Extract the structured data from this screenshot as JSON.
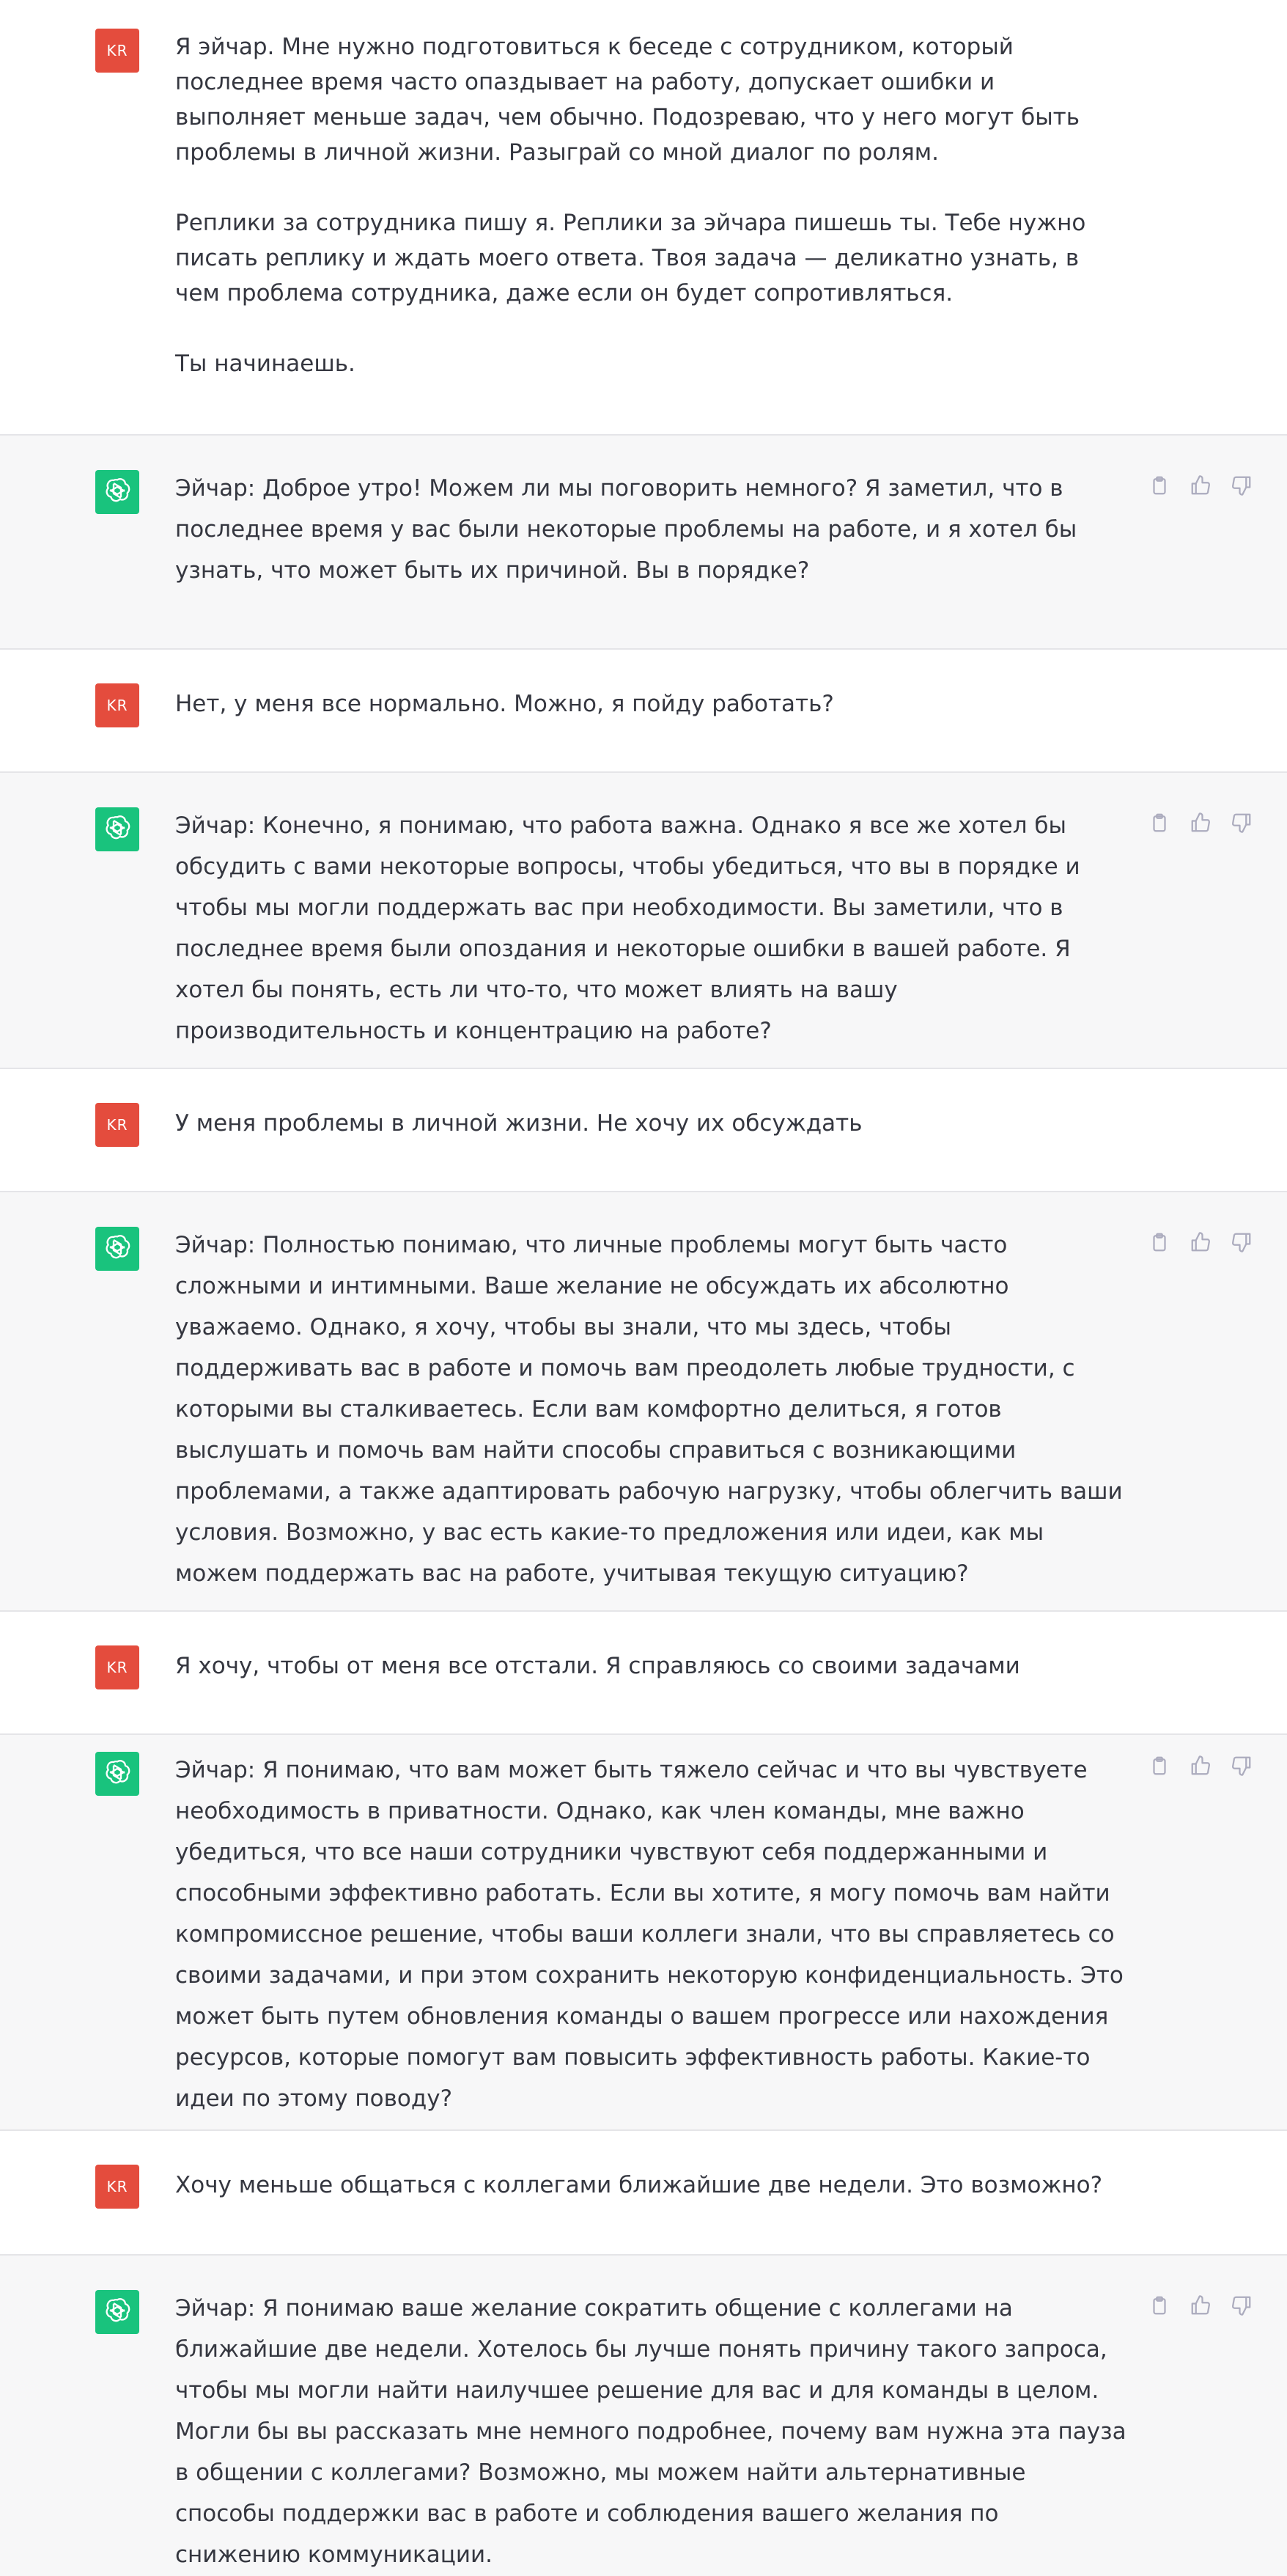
{
  "user": {
    "initials": "KR"
  },
  "messages": [
    {
      "role": "user",
      "paragraphs": [
        "Я эйчар. Мне нужно подготовиться к беседе с сотрудником, который последнее время часто опаздывает на работу, допускает ошибки и выполняет меньше задач, чем обычно. Подозреваю, что у него могут быть проблемы в личной жизни. Разыграй со мной диалог по ролям.",
        "Реплики за сотрудника пишу я. Реплики за эйчара пишешь ты. Тебе нужно писать реплику и ждать моего ответа. Твоя задача — деликатно узнать, в чем проблема сотрудника, даже если он будет сопротивляться.",
        "Ты начинаешь."
      ]
    },
    {
      "role": "assistant",
      "paragraphs": [
        "Эйчар: Доброе утро! Можем ли мы поговорить немного? Я заметил, что в последнее время у вас были некоторые проблемы на работе, и я хотел бы узнать, что может быть их причиной. Вы в порядке?"
      ]
    },
    {
      "role": "user",
      "paragraphs": [
        "Нет, у меня все нормально. Можно, я пойду работать?"
      ]
    },
    {
      "role": "assistant",
      "paragraphs": [
        "Эйчар: Конечно, я понимаю, что работа важна. Однако я все же хотел бы обсудить с вами некоторые вопросы, чтобы убедиться, что вы в порядке и чтобы мы могли поддержать вас при необходимости. Вы заметили, что в последнее время были опоздания и некоторые ошибки в вашей работе. Я хотел бы понять, есть ли что-то, что может влиять на вашу производительность и концентрацию на работе?"
      ]
    },
    {
      "role": "user",
      "paragraphs": [
        "У меня проблемы в личной жизни. Не хочу их обсуждать"
      ]
    },
    {
      "role": "assistant",
      "paragraphs": [
        "Эйчар: Полностью понимаю, что личные проблемы могут быть часто сложными и интимными. Ваше желание не обсуждать их абсолютно уважаемо. Однако, я хочу, чтобы вы знали, что мы здесь, чтобы поддерживать вас в работе и помочь вам преодолеть любые трудности, с которыми вы сталкиваетесь. Если вам комфортно делиться, я готов выслушать и помочь вам найти способы справиться с возникающими проблемами, а также адаптировать рабочую нагрузку, чтобы облегчить ваши условия. Возможно, у вас есть какие-то предложения или идеи, как мы можем поддержать вас на работе, учитывая текущую ситуацию?"
      ]
    },
    {
      "role": "user",
      "paragraphs": [
        "Я хочу, чтобы от меня все отстали. Я справляюсь со своими задачами"
      ]
    },
    {
      "role": "assistant",
      "paragraphs": [
        "Эйчар: Я понимаю, что вам может быть тяжело сейчас и что вы чувствуете необходимость в приватности. Однако, как член команды, мне важно убедиться, что все наши сотрудники чувствуют себя поддержанными и способными эффективно работать. Если вы хотите, я могу помочь вам найти компромиссное решение, чтобы ваши коллеги знали, что вы справляетесь со своими задачами, и при этом сохранить некоторую конфиденциальность. Это может быть путем обновления команды о вашем прогрессе или нахождения ресурсов, которые помогут вам повысить эффективность работы. Какие-то идеи по этому поводу?"
      ]
    },
    {
      "role": "user",
      "paragraphs": [
        "Хочу меньше общаться с коллегами ближайшие две недели. Это возможно?"
      ]
    },
    {
      "role": "assistant",
      "paragraphs": [
        "Эйчар: Я понимаю ваше желание сократить общение с коллегами на ближайшие две недели. Хотелось бы лучше понять причину такого запроса, чтобы мы могли найти наилучшее решение для вас и для команды в целом. Могли бы вы рассказать мне немного подробнее, почему вам нужна эта пауза в общении с коллегами? Возможно, мы можем найти альтернативные способы поддержки вас в работе и соблюдения вашего желания по снижению коммуникации."
      ]
    }
  ]
}
